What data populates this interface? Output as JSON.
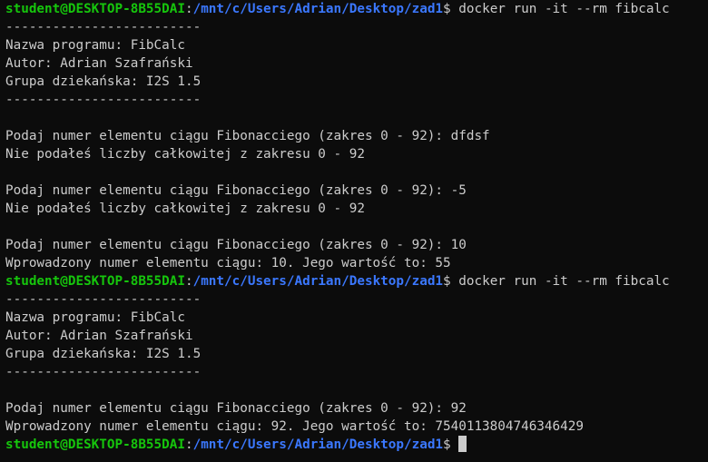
{
  "colors": {
    "background": "#0c0c0c",
    "text": "#cccccc",
    "prompt_user": "#16c60c",
    "prompt_path": "#3b78ff"
  },
  "prompt": {
    "user": "student@DESKTOP-8B55DAI",
    "separator": ":",
    "path": "/mnt/c/Users/Adrian/Desktop/zad1",
    "symbol": "$ "
  },
  "lines": [
    {
      "type": "prompt",
      "command": "docker run -it --rm fibcalc"
    },
    {
      "type": "output",
      "text": "-------------------------"
    },
    {
      "type": "output",
      "text": "Nazwa programu: FibCalc"
    },
    {
      "type": "output",
      "text": "Autor: Adrian Szafrański"
    },
    {
      "type": "output",
      "text": "Grupa dziekańska: I2S 1.5"
    },
    {
      "type": "output",
      "text": "-------------------------"
    },
    {
      "type": "output",
      "text": ""
    },
    {
      "type": "output",
      "text": "Podaj numer elementu ciągu Fibonacciego (zakres 0 - 92): dfdsf"
    },
    {
      "type": "output",
      "text": "Nie podałeś liczby całkowitej z zakresu 0 - 92"
    },
    {
      "type": "output",
      "text": ""
    },
    {
      "type": "output",
      "text": "Podaj numer elementu ciągu Fibonacciego (zakres 0 - 92): -5"
    },
    {
      "type": "output",
      "text": "Nie podałeś liczby całkowitej z zakresu 0 - 92"
    },
    {
      "type": "output",
      "text": ""
    },
    {
      "type": "output",
      "text": "Podaj numer elementu ciągu Fibonacciego (zakres 0 - 92): 10"
    },
    {
      "type": "output",
      "text": "Wprowadzony numer elementu ciągu: 10. Jego wartość to: 55"
    },
    {
      "type": "prompt",
      "command": "docker run -it --rm fibcalc"
    },
    {
      "type": "output",
      "text": "-------------------------"
    },
    {
      "type": "output",
      "text": "Nazwa programu: FibCalc"
    },
    {
      "type": "output",
      "text": "Autor: Adrian Szafrański"
    },
    {
      "type": "output",
      "text": "Grupa dziekańska: I2S 1.5"
    },
    {
      "type": "output",
      "text": "-------------------------"
    },
    {
      "type": "output",
      "text": ""
    },
    {
      "type": "output",
      "text": "Podaj numer elementu ciągu Fibonacciego (zakres 0 - 92): 92"
    },
    {
      "type": "output",
      "text": "Wprowadzony numer elementu ciągu: 92. Jego wartość to: 7540113804746346429"
    },
    {
      "type": "prompt",
      "command": "",
      "cursor": true
    }
  ]
}
